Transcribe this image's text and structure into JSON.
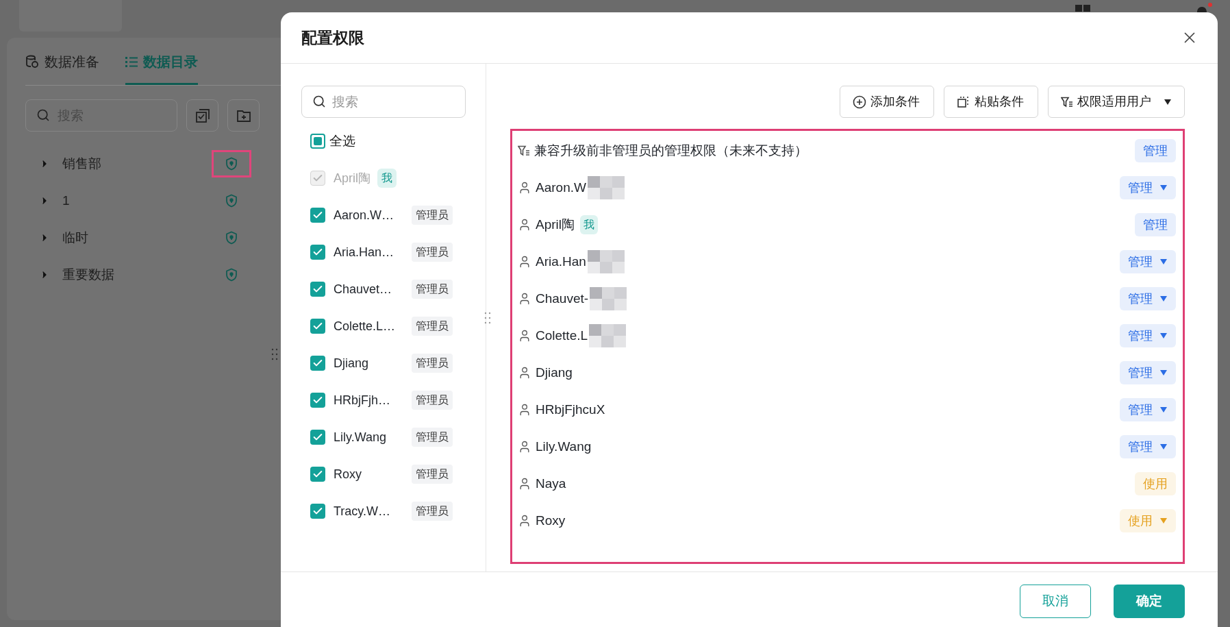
{
  "top_bar": {
    "has_notification": true
  },
  "side_panel": {
    "tabs": [
      {
        "label": "数据准备",
        "selected": false
      },
      {
        "label": "数据目录",
        "selected": true
      }
    ],
    "search": {
      "placeholder": "搜索"
    },
    "tree": [
      {
        "label": "销售部",
        "highlighted": true
      },
      {
        "label": "1",
        "highlighted": false
      },
      {
        "label": "临时",
        "highlighted": false
      },
      {
        "label": "重要数据",
        "highlighted": false
      }
    ]
  },
  "dialog": {
    "title": "配置权限",
    "member_search": {
      "placeholder": "搜索"
    },
    "select_all": {
      "label": "全选",
      "indeterminate": true
    },
    "members": [
      {
        "name": "April陶",
        "tag": "我",
        "checked": true,
        "disabled": true
      },
      {
        "name": "Aaron.W…",
        "tag": "管理员",
        "checked": true,
        "disabled": false
      },
      {
        "name": "Aria.Han…",
        "tag": "管理员",
        "checked": true,
        "disabled": false
      },
      {
        "name": "Chauvet…",
        "tag": "管理员",
        "checked": true,
        "disabled": false
      },
      {
        "name": "Colette.L…",
        "tag": "管理员",
        "checked": true,
        "disabled": false
      },
      {
        "name": "Djiang",
        "tag": "管理员",
        "checked": true,
        "disabled": false
      },
      {
        "name": "HRbjFjh…",
        "tag": "管理员",
        "checked": true,
        "disabled": false
      },
      {
        "name": "Lily.Wang",
        "tag": "管理员",
        "checked": true,
        "disabled": false
      },
      {
        "name": "Roxy",
        "tag": "管理员",
        "checked": true,
        "disabled": false
      },
      {
        "name": "Tracy.W…",
        "tag": "管理员",
        "checked": true,
        "disabled": false
      }
    ],
    "toolbar": [
      {
        "label": "添加条件",
        "dropdown": false
      },
      {
        "label": "粘贴条件",
        "dropdown": false
      },
      {
        "label": "权限适用用户",
        "dropdown": true
      }
    ],
    "rules_highlighted": true,
    "rules": [
      {
        "kind": "condition",
        "name": "兼容升级前非管理员的管理权限（未来不支持）",
        "blurred": false,
        "permission": "管理",
        "color": "#2b6de5",
        "dropdown": false
      },
      {
        "kind": "user",
        "name": "Aaron.W",
        "blurred": true,
        "permission": "管理",
        "color": "#2b6de5",
        "dropdown": true
      },
      {
        "kind": "user",
        "name": "April陶",
        "me_tag": "我",
        "blurred": false,
        "permission": "管理",
        "color": "#2b6de5",
        "dropdown": false
      },
      {
        "kind": "user",
        "name": "Aria.Han",
        "blurred": true,
        "permission": "管理",
        "color": "#2b6de5",
        "dropdown": true
      },
      {
        "kind": "user",
        "name": "Chauvet-",
        "blurred": true,
        "permission": "管理",
        "color": "#2b6de5",
        "dropdown": true
      },
      {
        "kind": "user",
        "name": "Colette.L",
        "blurred": true,
        "permission": "管理",
        "color": "#2b6de5",
        "dropdown": true
      },
      {
        "kind": "user",
        "name": "Djiang",
        "blurred": false,
        "permission": "管理",
        "color": "#2b6de5",
        "dropdown": true
      },
      {
        "kind": "user",
        "name": "HRbjFjhcuX",
        "blurred": false,
        "permission": "管理",
        "color": "#2b6de5",
        "dropdown": true
      },
      {
        "kind": "user",
        "name": "Lily.Wang",
        "blurred": false,
        "permission": "管理",
        "color": "#2b6de5",
        "dropdown": true
      },
      {
        "kind": "user",
        "name": "Naya",
        "blurred": false,
        "permission": "使用",
        "color": "#e5a11f",
        "dropdown": false
      },
      {
        "kind": "user",
        "name": "Roxy",
        "blurred": false,
        "permission": "使用",
        "color": "#e5a11f",
        "dropdown": true
      }
    ],
    "buttons": [
      {
        "label": "取消",
        "primary": false
      },
      {
        "label": "确定",
        "primary": true
      }
    ]
  }
}
